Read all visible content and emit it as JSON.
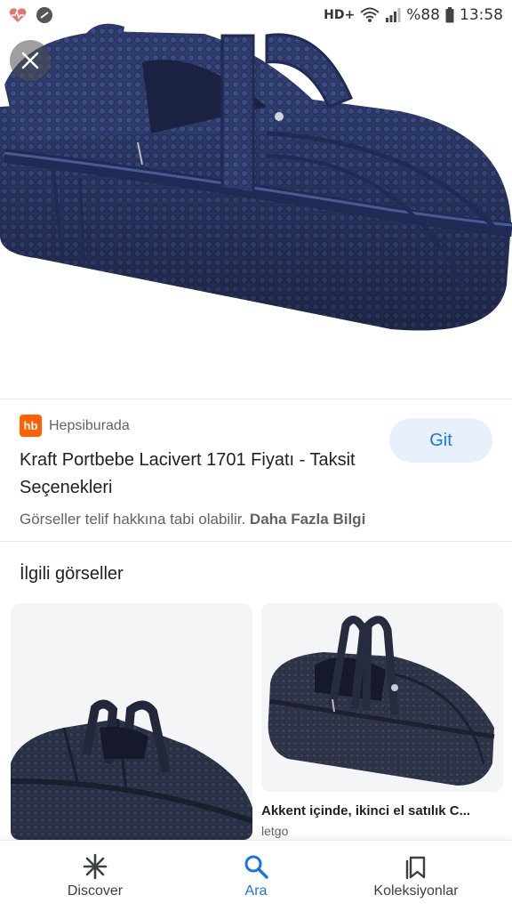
{
  "status_bar": {
    "network": "HD+",
    "battery": "%88",
    "time": "13:58"
  },
  "hero": {
    "close_icon": "close-icon"
  },
  "source": {
    "logo_text": "hb",
    "name": "Hepsiburada"
  },
  "result": {
    "title": "Kraft Portbebe Lacivert 1701 Fiyatı - Taksit Seçenekleri",
    "visit_label": "Git",
    "copyright_text": "Görseller telif hakkına tabi olabilir.",
    "more_info_label": "Daha Fazla Bilgi"
  },
  "related": {
    "heading": "İlgili görseller",
    "items": [
      {
        "caption": "",
        "source": ""
      },
      {
        "caption": "Akkent içinde, ikinci el satılık C...",
        "source": "letgo"
      }
    ]
  },
  "bottom_nav": {
    "items": [
      {
        "label": "Discover",
        "icon": "asterisk-icon"
      },
      {
        "label": "Ara",
        "icon": "search-icon"
      },
      {
        "label": "Koleksiyonlar",
        "icon": "collections-icon"
      }
    ],
    "active_index": 1
  },
  "colors": {
    "accent": "#1a73e8",
    "brand_logo": "#ff6000",
    "bag_navy": "#2e3b6b"
  }
}
